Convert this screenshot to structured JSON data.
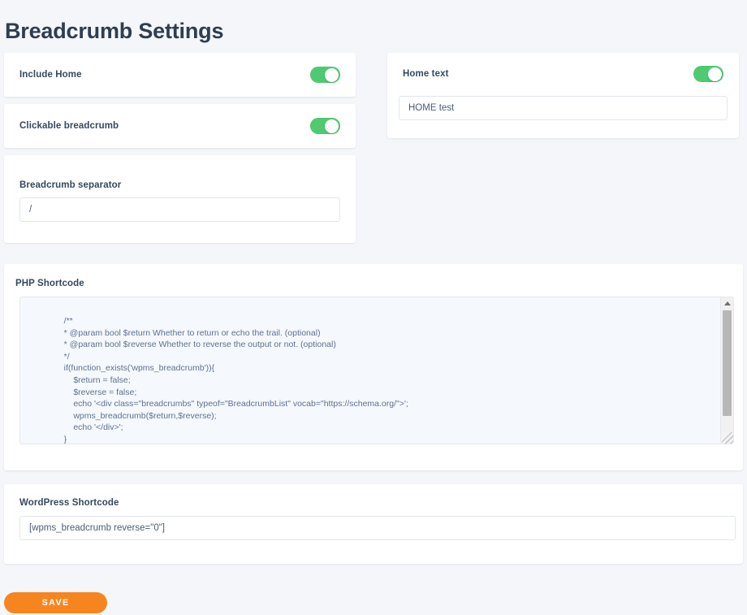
{
  "page": {
    "title": "Breadcrumb Settings",
    "background_color": "#f4f6f9",
    "title_color": "#2e3e50"
  },
  "settings": {
    "include_home": {
      "label": "Include Home",
      "toggle_state": "on",
      "toggle_color": "#4ECB71"
    },
    "clickable_breadcrumb": {
      "label": "Clickable breadcrumb",
      "toggle_state": "on",
      "toggle_color": "#4ECB71"
    },
    "breadcrumb_separator": {
      "label": "Breadcrumb separator",
      "value": "/",
      "placeholder": "/"
    },
    "home_text": {
      "label": "Home text",
      "toggle_state": "on",
      "toggle_color": "#4ECB71",
      "value": "HOME test",
      "placeholder": "HOME test"
    }
  },
  "php_shortcode": {
    "label": "PHP Shortcode",
    "code": "    /**\n    * @param bool $return Whether to return or echo the trail. (optional)\n    * @param bool $reverse Whether to reverse the output or not. (optional)\n    */\n    if(function_exists('wpms_breadcrumb')){\n        $return = false;\n        $reverse = false;\n        echo '<div class=\"breadcrumbs\" typeof=\"BreadcrumbList\" vocab=\"https://schema.org/\">';\n        wpms_breadcrumb($return,$reverse);\n        echo '</div>';\n    }",
    "scrollbar": {
      "up_arrow": "scroll-up",
      "down_arrow": "scroll-down"
    }
  },
  "wordpress_shortcode": {
    "label": "WordPress Shortcode",
    "value": "[wpms_breadcrumb reverse=\"0\"]"
  },
  "actions": {
    "save_label": "SAVE",
    "save_color": "#F7851F"
  }
}
